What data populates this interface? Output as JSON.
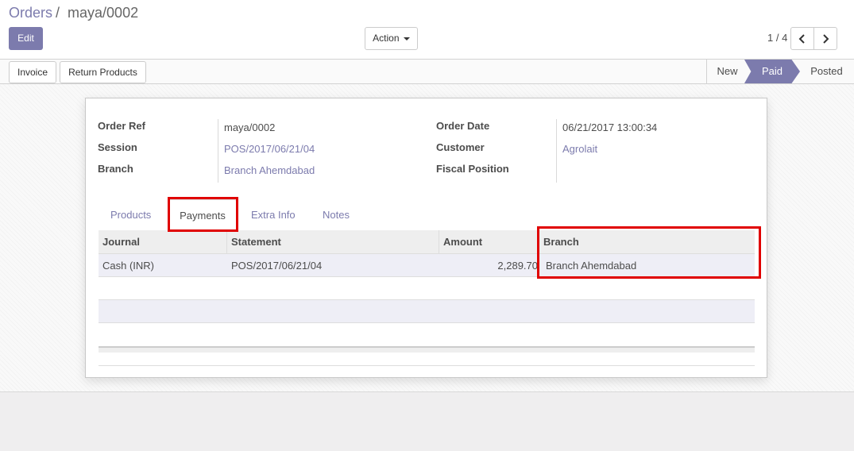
{
  "breadcrumb": {
    "parent": "Orders",
    "separator": "/",
    "current": "maya/0002"
  },
  "control": {
    "edit_label": "Edit",
    "action_label": "Action"
  },
  "pager": {
    "value": "1 / 4"
  },
  "statusbar": {
    "buttons": {
      "invoice": "Invoice",
      "return_products": "Return Products"
    },
    "stages": {
      "new": "New",
      "paid": "Paid",
      "posted": "Posted"
    },
    "active_stage": "Paid"
  },
  "form": {
    "order_ref": {
      "label": "Order Ref",
      "value": "maya/0002"
    },
    "session": {
      "label": "Session",
      "value": "POS/2017/06/21/04"
    },
    "branch": {
      "label": "Branch",
      "value": "Branch Ahemdabad"
    },
    "order_date": {
      "label": "Order Date",
      "value": "06/21/2017 13:00:34"
    },
    "customer": {
      "label": "Customer",
      "value": "Agrolait"
    },
    "fiscal_position": {
      "label": "Fiscal Position",
      "value": ""
    }
  },
  "tabs": {
    "products": "Products",
    "payments": "Payments",
    "extra_info": "Extra Info",
    "notes": "Notes"
  },
  "active_tab": "Payments",
  "payments_table": {
    "headers": {
      "journal": "Journal",
      "statement": "Statement",
      "amount": "Amount",
      "branch": "Branch"
    },
    "rows": [
      {
        "journal": "Cash (INR)",
        "statement": "POS/2017/06/21/04",
        "amount": "2,289.70",
        "branch": "Branch Ahemdabad"
      }
    ]
  },
  "colors": {
    "accent": "#7c7bad",
    "highlight": "#e00000",
    "row_bg": "#eeeef6"
  }
}
